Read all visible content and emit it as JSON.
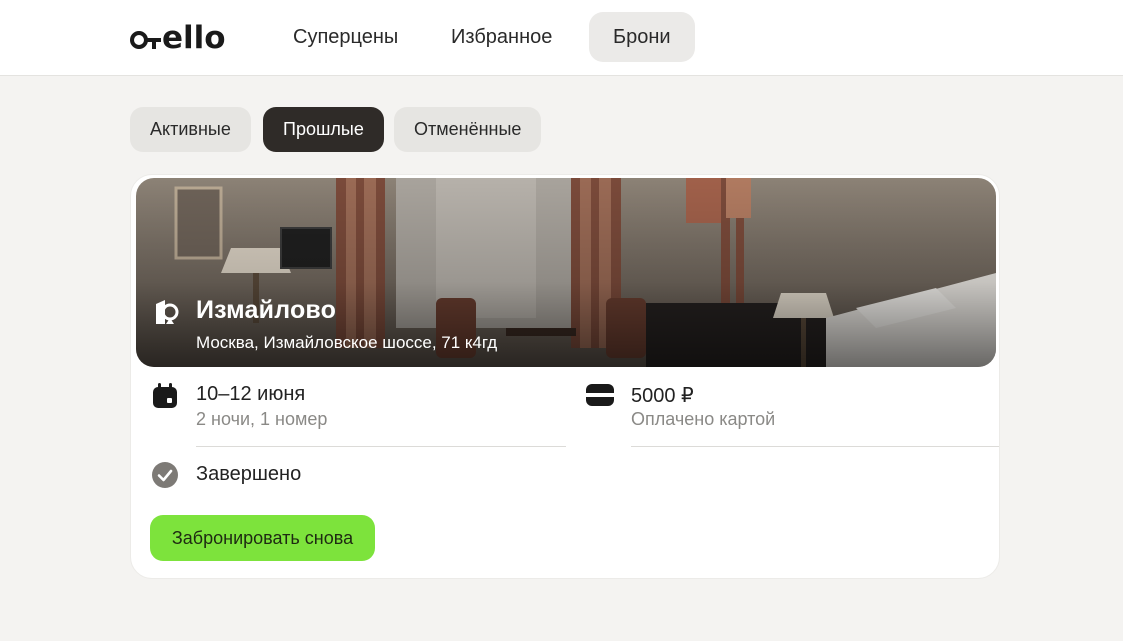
{
  "header": {
    "logo_text": "otello",
    "nav": [
      {
        "label": "Суперцены",
        "active": false
      },
      {
        "label": "Избранное",
        "active": false
      },
      {
        "label": "Брони",
        "active": true
      }
    ]
  },
  "filters": {
    "tabs": [
      {
        "label": "Активные",
        "active": false
      },
      {
        "label": "Прошлые",
        "active": true
      },
      {
        "label": "Отменённые",
        "active": false
      }
    ]
  },
  "booking": {
    "hotel_name": "Измайлово",
    "address": "Москва, Измайловское шоссе, 71 к4гд",
    "dates": "10–12 июня",
    "details": "2 ночи, 1 номер",
    "price": "5000 ₽",
    "payment": "Оплачено картой",
    "status": "Завершено",
    "rebook_label": "Забронировать снова"
  },
  "colors": {
    "background": "#f4f3f1",
    "accent_green": "#7de33c",
    "active_chip": "#2f2b28",
    "muted_text": "#8a8986"
  },
  "icons": {
    "hotel": "hotel-building-icon",
    "dates": "calendar-icon",
    "payment": "card-icon",
    "status": "check-circle-icon"
  }
}
